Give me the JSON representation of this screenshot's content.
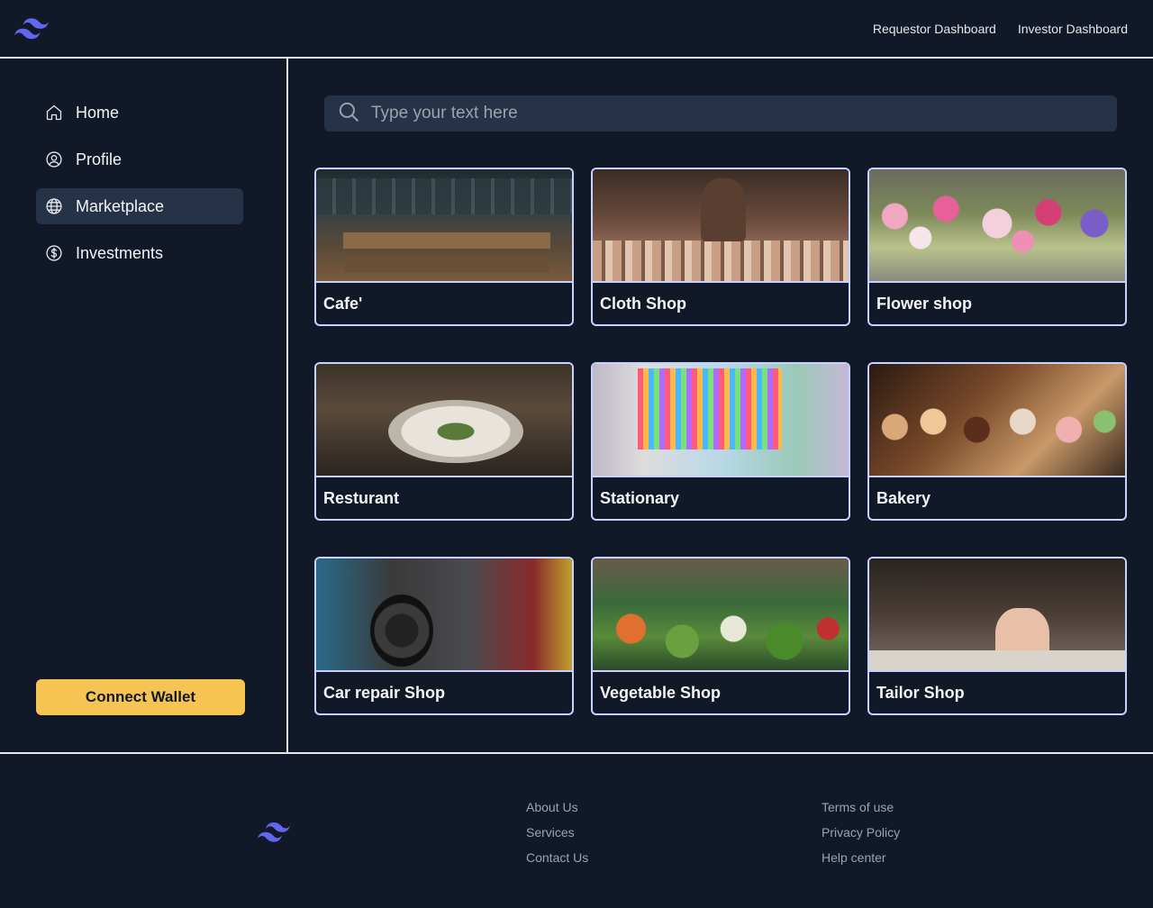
{
  "header": {
    "logo_icon": "tailwind-wave-logo",
    "links": [
      "Requestor Dashboard",
      "Investor Dashboard"
    ]
  },
  "sidebar": {
    "items": [
      {
        "label": "Home",
        "icon": "home-icon",
        "active": false
      },
      {
        "label": "Profile",
        "icon": "user-circle-icon",
        "active": false
      },
      {
        "label": "Marketplace",
        "icon": "globe-icon",
        "active": true
      },
      {
        "label": "Investments",
        "icon": "dollar-circle-icon",
        "active": false
      }
    ],
    "connect_wallet": "Connect Wallet"
  },
  "search": {
    "placeholder": "Type your text here",
    "value": ""
  },
  "cards": [
    {
      "title": "Cafe'"
    },
    {
      "title": "Cloth Shop"
    },
    {
      "title": "Flower shop"
    },
    {
      "title": "Resturant"
    },
    {
      "title": "Stationary"
    },
    {
      "title": "Bakery"
    },
    {
      "title": "Car repair Shop"
    },
    {
      "title": "Vegetable Shop"
    },
    {
      "title": "Tailor Shop"
    }
  ],
  "footer": {
    "col1": [
      "About Us",
      "Services",
      "Contact Us"
    ],
    "col2": [
      "Terms of use",
      "Privacy Policy",
      "Help center"
    ]
  },
  "colors": {
    "background": "#111827",
    "active_nav": "#263247",
    "accent_button": "#f6c453",
    "logo": "#6366f1",
    "card_border": "#c7d2fe"
  }
}
